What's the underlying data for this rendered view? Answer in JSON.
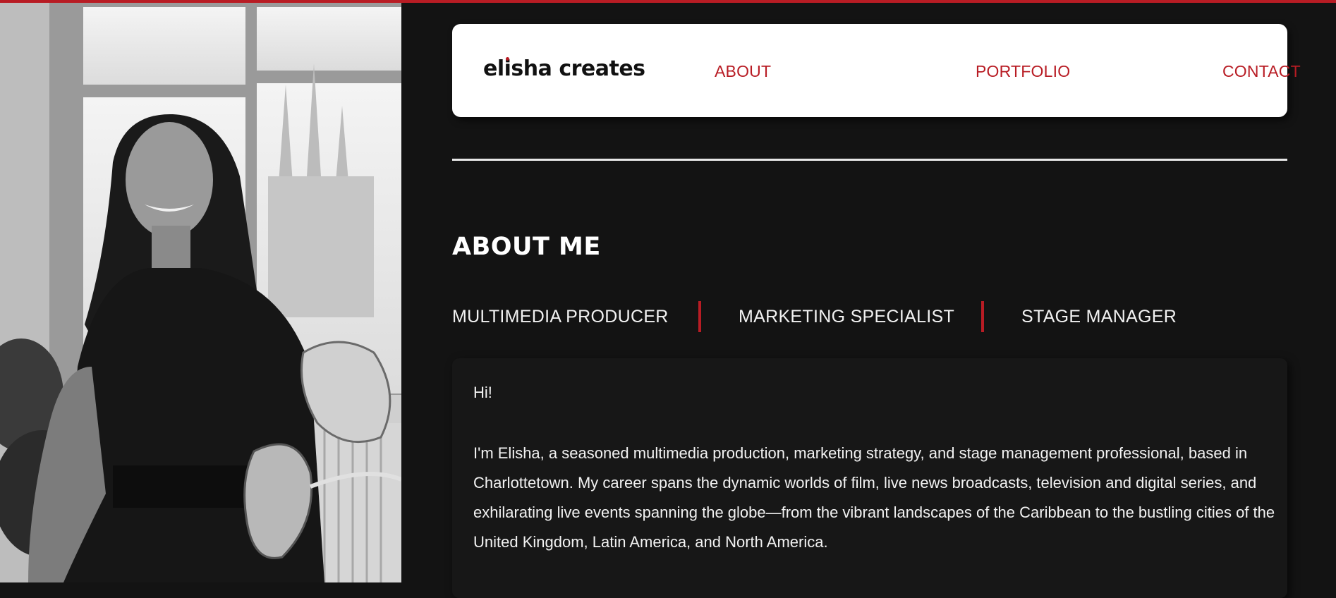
{
  "header": {
    "logo_text": "elisha creates",
    "nav": {
      "about": "ABOUT",
      "portfolio": "PORTFOLIO",
      "contact": "CONTACT"
    }
  },
  "about": {
    "title": "ABOUT ME",
    "roles": [
      "MULTIMEDIA PRODUCER",
      "MARKETING SPECIALIST",
      "STAGE MANAGER"
    ],
    "greeting": "Hi!",
    "bio": "I'm Elisha, a seasoned multimedia production, marketing strategy, and stage management professional, based in Charlottetown. My career spans the dynamic worlds of film, live news broadcasts, television and digital series, and exhilarating live events spanning the globe—from the vibrant landscapes of the Caribbean to the bustling cities of the United Kingdom, Latin America, and North America."
  },
  "theme": {
    "accent": "#b81c24",
    "background": "#131313",
    "card": "#171717",
    "text": "#f2f2f2"
  }
}
